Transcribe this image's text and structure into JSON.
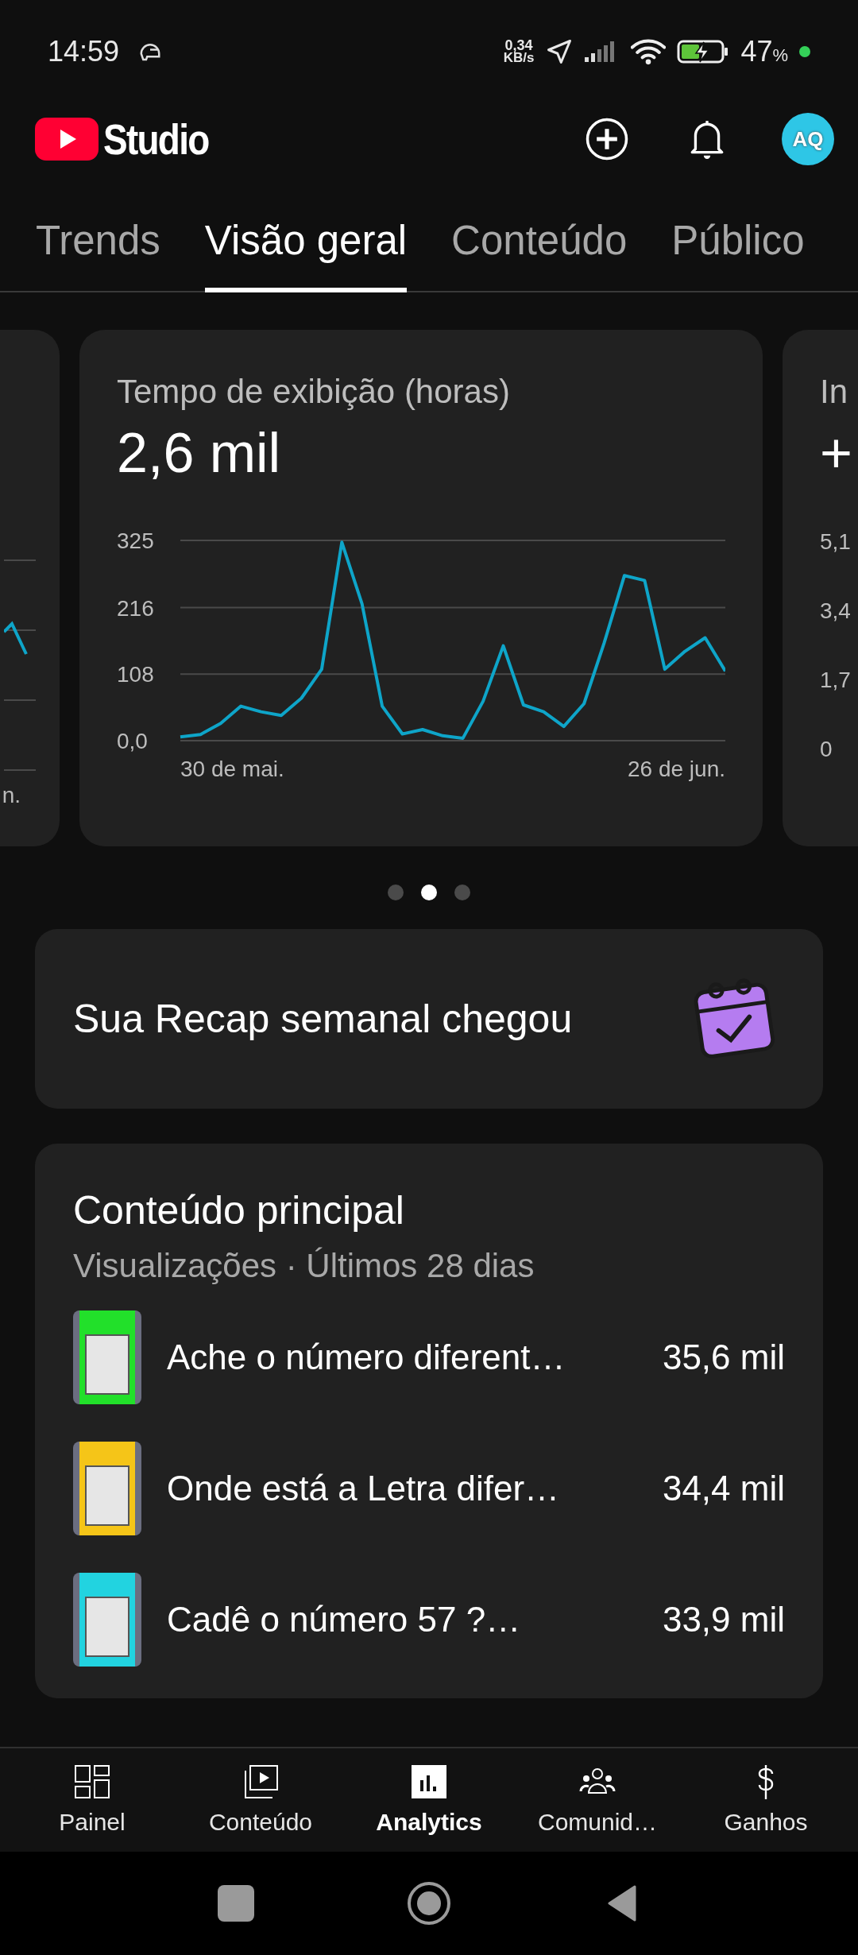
{
  "status_bar": {
    "time": "14:59",
    "speed": "0,34",
    "speed_unit": "KB/s",
    "battery": "47",
    "battery_unit": "%"
  },
  "header": {
    "logo_text": "Studio",
    "avatar": "AQ"
  },
  "tabs": [
    {
      "label": "Trends",
      "selected": false
    },
    {
      "label": "Visão geral",
      "selected": true
    },
    {
      "label": "Conteúdo",
      "selected": false
    },
    {
      "label": "Público",
      "selected": false
    }
  ],
  "cards": [
    {
      "kind": "partial_left",
      "x_label": "n."
    },
    {
      "kind": "chart",
      "title": "Tempo de exibição (horas)",
      "value": "2,6 mil",
      "start_label": "30 de mai.",
      "end_label": "26 de jun.",
      "chart_data": {
        "type": "line",
        "series": [
          {
            "color": "#0ea5c9",
            "values": [
              6,
              10,
              28,
              56,
              47,
              41,
              69,
              116,
              322,
              222,
              56,
              11,
              18,
              8,
              4,
              64,
              154,
              58,
              47,
              23,
              60,
              159,
              268,
              260,
              116,
              145,
              167,
              113
            ]
          }
        ],
        "ylim": [
          0,
          325
        ],
        "yticks": [
          {
            "value": 0,
            "label": "0,0"
          },
          {
            "value": 108,
            "label": "108"
          },
          {
            "value": 216,
            "label": "216"
          },
          {
            "value": 325,
            "label": "325"
          }
        ]
      }
    },
    {
      "kind": "partial_right",
      "title": "In",
      "value": "+",
      "y_labels": [
        "5,1",
        "3,4",
        "1,7",
        "0"
      ]
    }
  ],
  "pager": [
    {
      "selected": false
    },
    {
      "selected": true
    },
    {
      "selected": false
    }
  ],
  "recap": {
    "text": "Sua Recap semanal chegou"
  },
  "top_content": {
    "title": "Conteúdo principal",
    "subtitle": "Visualizações · Últimos 28 dias",
    "items": [
      {
        "title": "Ache o número diferent…",
        "views": "35,6 mil",
        "color": "#22e02a"
      },
      {
        "title": "Onde está a Letra difer…",
        "views": "34,4 mil",
        "color": "#f5c518"
      },
      {
        "title": "Cadê o número 57 ?…",
        "views": "33,9 mil",
        "color": "#22d3e0"
      }
    ]
  },
  "nav": [
    {
      "label": "Painel",
      "kind": "dashboard",
      "selected": false
    },
    {
      "label": "Conteúdo",
      "kind": "content",
      "selected": false
    },
    {
      "label": "Analytics",
      "kind": "analytics",
      "selected": true
    },
    {
      "label": "Comunid…",
      "kind": "community",
      "selected": false
    },
    {
      "label": "Ganhos",
      "kind": "earnings",
      "selected": false
    }
  ]
}
